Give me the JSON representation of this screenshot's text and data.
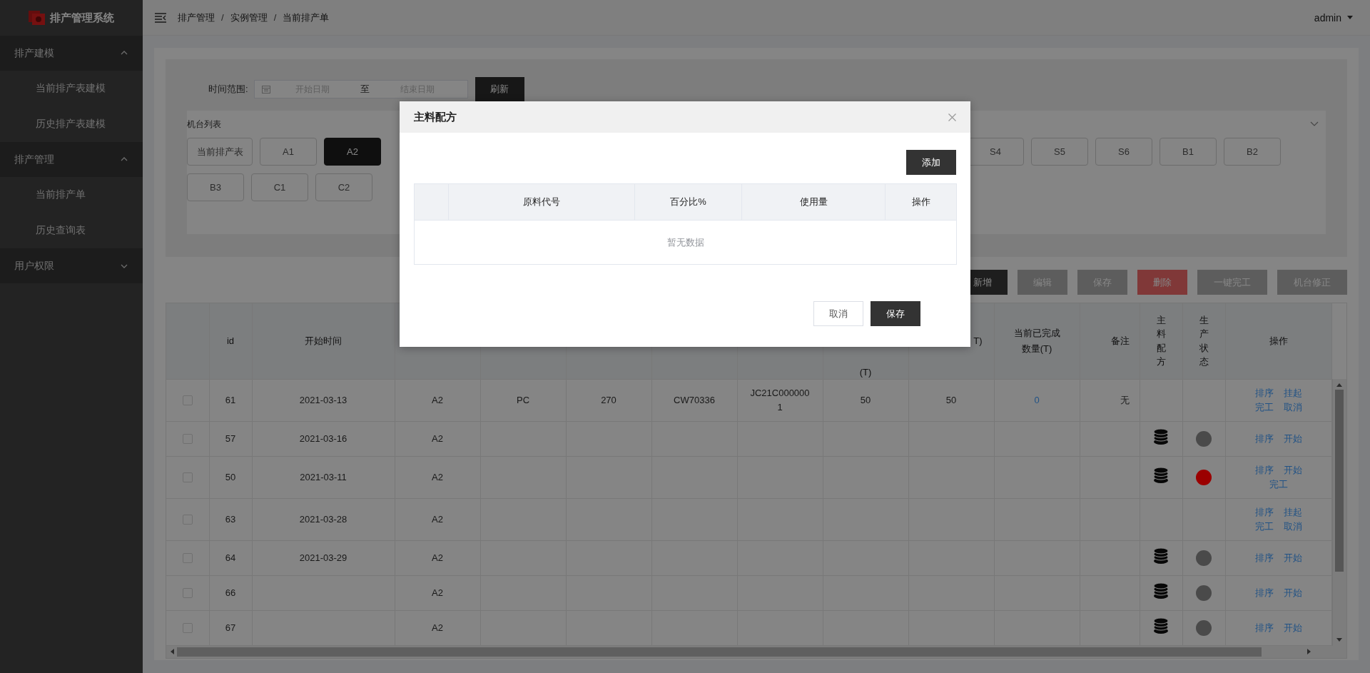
{
  "app": {
    "title": "排产管理系统"
  },
  "sidebar": {
    "groups": [
      {
        "label": "排产建模",
        "expanded": true,
        "children": [
          {
            "label": "当前排产表建模"
          },
          {
            "label": "历史排产表建模"
          }
        ]
      },
      {
        "label": "排产管理",
        "expanded": true,
        "children": [
          {
            "label": "当前排产单"
          },
          {
            "label": "历史查询表"
          }
        ]
      },
      {
        "label": "用户权限",
        "expanded": false
      }
    ]
  },
  "header": {
    "breadcrumb": [
      "排产管理",
      "实例管理",
      "当前排产单"
    ],
    "separator": "/",
    "user": "admin"
  },
  "filter": {
    "label": "时间范围:",
    "start_placeholder": "开始日期",
    "separator": "至",
    "end_placeholder": "结束日期",
    "refresh_button": "刷新"
  },
  "machine_list": {
    "title": "机台列表",
    "expanded": true,
    "rows": [
      {
        "start": [
          {
            "label": "当前排产表",
            "selected": false
          },
          {
            "label": "A1",
            "selected": false
          },
          {
            "label": "A2",
            "selected": true
          }
        ],
        "end": [
          {
            "label": "S4",
            "selected": false
          },
          {
            "label": "S5",
            "selected": false
          },
          {
            "label": "S6",
            "selected": false
          },
          {
            "label": "B1",
            "selected": false
          },
          {
            "label": "B2",
            "selected": false
          }
        ]
      },
      {
        "start": [
          {
            "label": "B3",
            "selected": false
          },
          {
            "label": "C1",
            "selected": false
          },
          {
            "label": "C2",
            "selected": false
          }
        ]
      }
    ]
  },
  "toolbar": [
    {
      "label": "新增",
      "kind": "primary",
      "disabled": false
    },
    {
      "label": "编辑",
      "kind": "primary",
      "disabled": true
    },
    {
      "label": "保存",
      "kind": "primary",
      "disabled": true
    },
    {
      "label": "删除",
      "kind": "danger",
      "disabled": true
    },
    {
      "label": "一键完工",
      "kind": "primary",
      "disabled": true
    },
    {
      "label": "机台修正",
      "kind": "primary",
      "disabled": true
    }
  ],
  "table": {
    "headers": {
      "id": "id",
      "start_time": "开始时间",
      "column_9": "(T)",
      "column_10": "T)",
      "completed_qty": "当前已完成数量(T)",
      "note": "备注",
      "recipe": "主料配方",
      "status": "生产状态",
      "actions": "操作"
    },
    "rows": [
      {
        "checked": false,
        "id": "61",
        "start_time": "2021-03-13",
        "column_4": "A2",
        "column_5": "PC",
        "column_6": "270",
        "column_7": "CW70336",
        "column_8": "JC21C0000001",
        "column_9": "50",
        "column_10": "50",
        "completed_qty": "0",
        "note": "无",
        "recipe": false,
        "actions": [
          "排序",
          "挂起",
          "完工",
          "取消"
        ]
      },
      {
        "checked": false,
        "id": "57",
        "start_time": "2021-03-16",
        "column_4": "A2",
        "recipe": true,
        "color": "#4a4a4a",
        "actions": [
          "排序",
          "开始"
        ]
      },
      {
        "checked": false,
        "id": "50",
        "start_time": "2021-03-11",
        "column_4": "A2",
        "recipe": true,
        "color": "#9b0000",
        "actions": [
          "排序",
          "开始",
          "完工"
        ]
      },
      {
        "checked": false,
        "id": "63",
        "start_time": "2021-03-28",
        "column_4": "A2",
        "recipe": false,
        "actions": [
          "排序",
          "挂起",
          "完工",
          "取消"
        ]
      },
      {
        "checked": false,
        "id": "64",
        "start_time": "2021-03-29",
        "column_4": "A2",
        "recipe": true,
        "color": "#4a4a4a",
        "actions": [
          "排序",
          "开始"
        ]
      },
      {
        "checked": false,
        "id": "66",
        "column_4": "A2",
        "recipe": true,
        "color": "#4a4a4a",
        "actions": [
          "排序",
          "开始"
        ]
      },
      {
        "checked": false,
        "id": "67",
        "column_4": "A2",
        "recipe": true,
        "color": "#4a4a4a",
        "actions": [
          "排序",
          "开始"
        ]
      }
    ]
  },
  "dialog": {
    "title": "主料配方",
    "add_button": "添加",
    "columns": [
      "原料代号",
      "百分比%",
      "使用量",
      "操作"
    ],
    "empty_text": "暂无数据",
    "cancel_button": "取消",
    "save_button": "保存"
  }
}
